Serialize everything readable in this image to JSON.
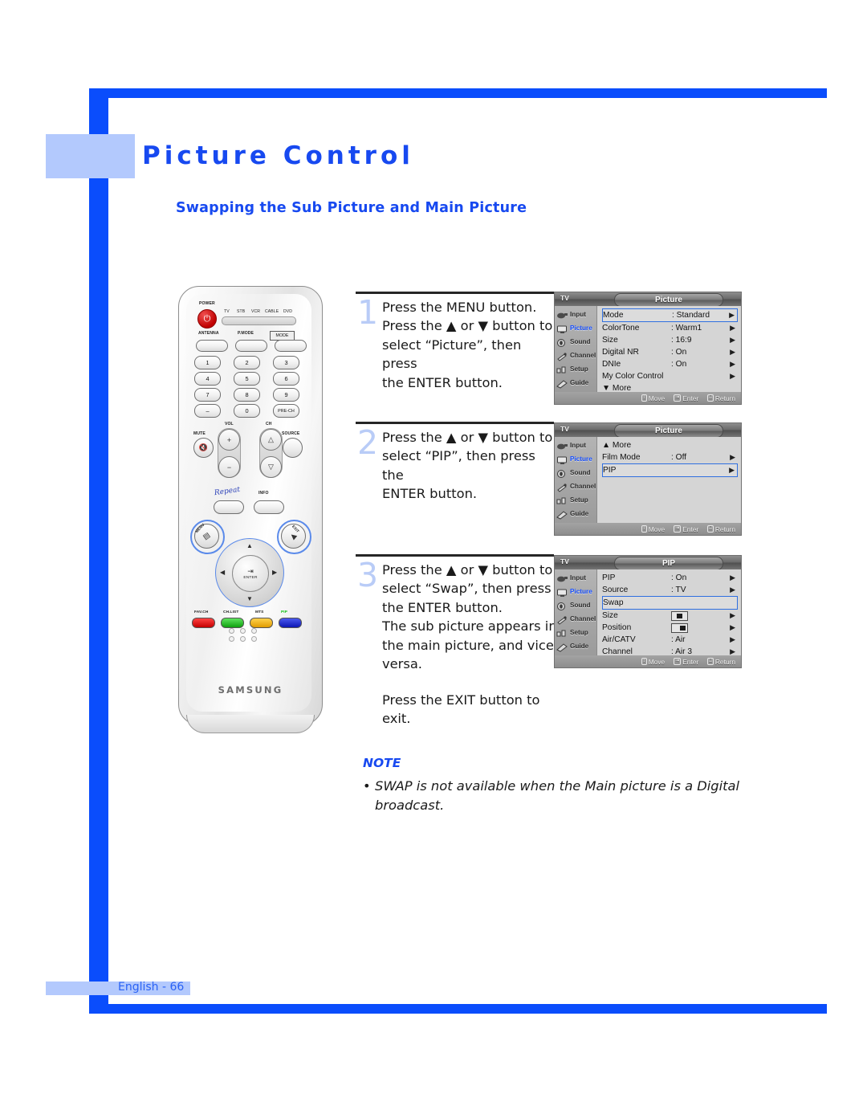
{
  "page": {
    "title": "Picture Control",
    "section_title": "Swapping the Sub Picture and Main Picture",
    "footer": "English - 66"
  },
  "steps": [
    {
      "number": "1",
      "lines": [
        "Press the MENU button.",
        "Press the ▲ or ▼ button to",
        "select “Picture”, then press",
        "the ENTER button."
      ]
    },
    {
      "number": "2",
      "lines": [
        "Press the ▲ or ▼ button to",
        "select “PIP”, then press the",
        "ENTER button."
      ]
    },
    {
      "number": "3",
      "lines": [
        "Press the ▲ or ▼ button to",
        "select “Swap”, then press",
        "the ENTER button.",
        "The sub picture appears in",
        "the main picture, and vice",
        "versa."
      ],
      "exit_line": "Press the EXIT button to exit."
    }
  ],
  "note": {
    "heading": "NOTE",
    "bullet": "•",
    "text": "SWAP is not available when the Main picture is a Digital broadcast."
  },
  "osd_sidebar": [
    {
      "label": "Input",
      "icon": "input-icon",
      "selected": false
    },
    {
      "label": "Picture",
      "icon": "picture-icon",
      "selected": true
    },
    {
      "label": "Sound",
      "icon": "sound-icon",
      "selected": false
    },
    {
      "label": "Channel",
      "icon": "channel-icon",
      "selected": false
    },
    {
      "label": "Setup",
      "icon": "setup-icon",
      "selected": false
    },
    {
      "label": "Guide",
      "icon": "guide-icon",
      "selected": false
    }
  ],
  "osd_footer": {
    "move": "Move",
    "enter": "Enter",
    "return": "Return"
  },
  "menus": [
    {
      "source_label": "TV",
      "title": "Picture",
      "rows": [
        {
          "key": "Mode",
          "value": ": Standard",
          "arrow": "▶",
          "selected": true
        },
        {
          "key": "ColorTone",
          "value": ": Warm1",
          "arrow": "▶",
          "selected": false
        },
        {
          "key": "Size",
          "value": ": 16:9",
          "arrow": "▶",
          "selected": false
        },
        {
          "key": "Digital NR",
          "value": ": On",
          "arrow": "▶",
          "selected": false
        },
        {
          "key": "DNIe",
          "value": ": On",
          "arrow": "▶",
          "selected": false
        },
        {
          "key": "My Color Control",
          "value": "",
          "arrow": "▶",
          "selected": false
        },
        {
          "key": "▼ More",
          "value": "",
          "arrow": "",
          "selected": false
        }
      ]
    },
    {
      "source_label": "TV",
      "title": "Picture",
      "rows": [
        {
          "key": "▲ More",
          "value": "",
          "arrow": "",
          "selected": false
        },
        {
          "key": "Film Mode",
          "value": ": Off",
          "arrow": "▶",
          "selected": false
        },
        {
          "key": "PIP",
          "value": "",
          "arrow": "▶",
          "selected": true
        }
      ]
    },
    {
      "source_label": "TV",
      "title": "PIP",
      "rows": [
        {
          "key": "PIP",
          "value": ": On",
          "arrow": "▶",
          "selected": false
        },
        {
          "key": "Source",
          "value": ": TV",
          "arrow": "▶",
          "selected": false
        },
        {
          "key": "Swap",
          "value": "",
          "arrow": "",
          "selected": true
        },
        {
          "key": "Size",
          "value": "[pip-center]",
          "arrow": "▶",
          "selected": false
        },
        {
          "key": "Position",
          "value": "[pip-right]",
          "arrow": "▶",
          "selected": false
        },
        {
          "key": "Air/CATV",
          "value": ": Air",
          "arrow": "▶",
          "selected": false
        },
        {
          "key": "Channel",
          "value": ": Air 3",
          "arrow": "▶",
          "selected": false
        }
      ]
    }
  ],
  "remote": {
    "brand": "SAMSUNG",
    "power_label": "POWER",
    "device_modes": [
      "TV",
      "STB",
      "VCR",
      "CABLE",
      "DVD"
    ],
    "function_labels": [
      "ANTENNA",
      "P.MODE",
      "MODE"
    ],
    "keypad": [
      "1",
      "2",
      "3",
      "4",
      "5",
      "6",
      "7",
      "8",
      "9",
      "–",
      "0",
      "PRE-CH"
    ],
    "mute_label": "MUTE",
    "vol_label": "VOL",
    "ch_label": "CH",
    "source_label": "SOURCE",
    "info_label": "INFO",
    "repeat_label": "Repeat",
    "menu_label": "MENU",
    "exit_label": "EXIT",
    "enter_label": "ENTER",
    "color_buttons": [
      {
        "label": "FAV.CH",
        "color": "#e61f1f"
      },
      {
        "label": "CH.LIST",
        "color": "#18c018"
      },
      {
        "label": "MTS",
        "color": "#f0b40a"
      },
      {
        "label": "PIP",
        "color": "#1322e0",
        "label_color": "#0fbe0f"
      }
    ]
  },
  "colors": {
    "brand_blue": "#1749f0",
    "frame_blue": "#0a4dfc",
    "band_blue": "#b3c9fd",
    "step_number": "#b9ccf7"
  }
}
